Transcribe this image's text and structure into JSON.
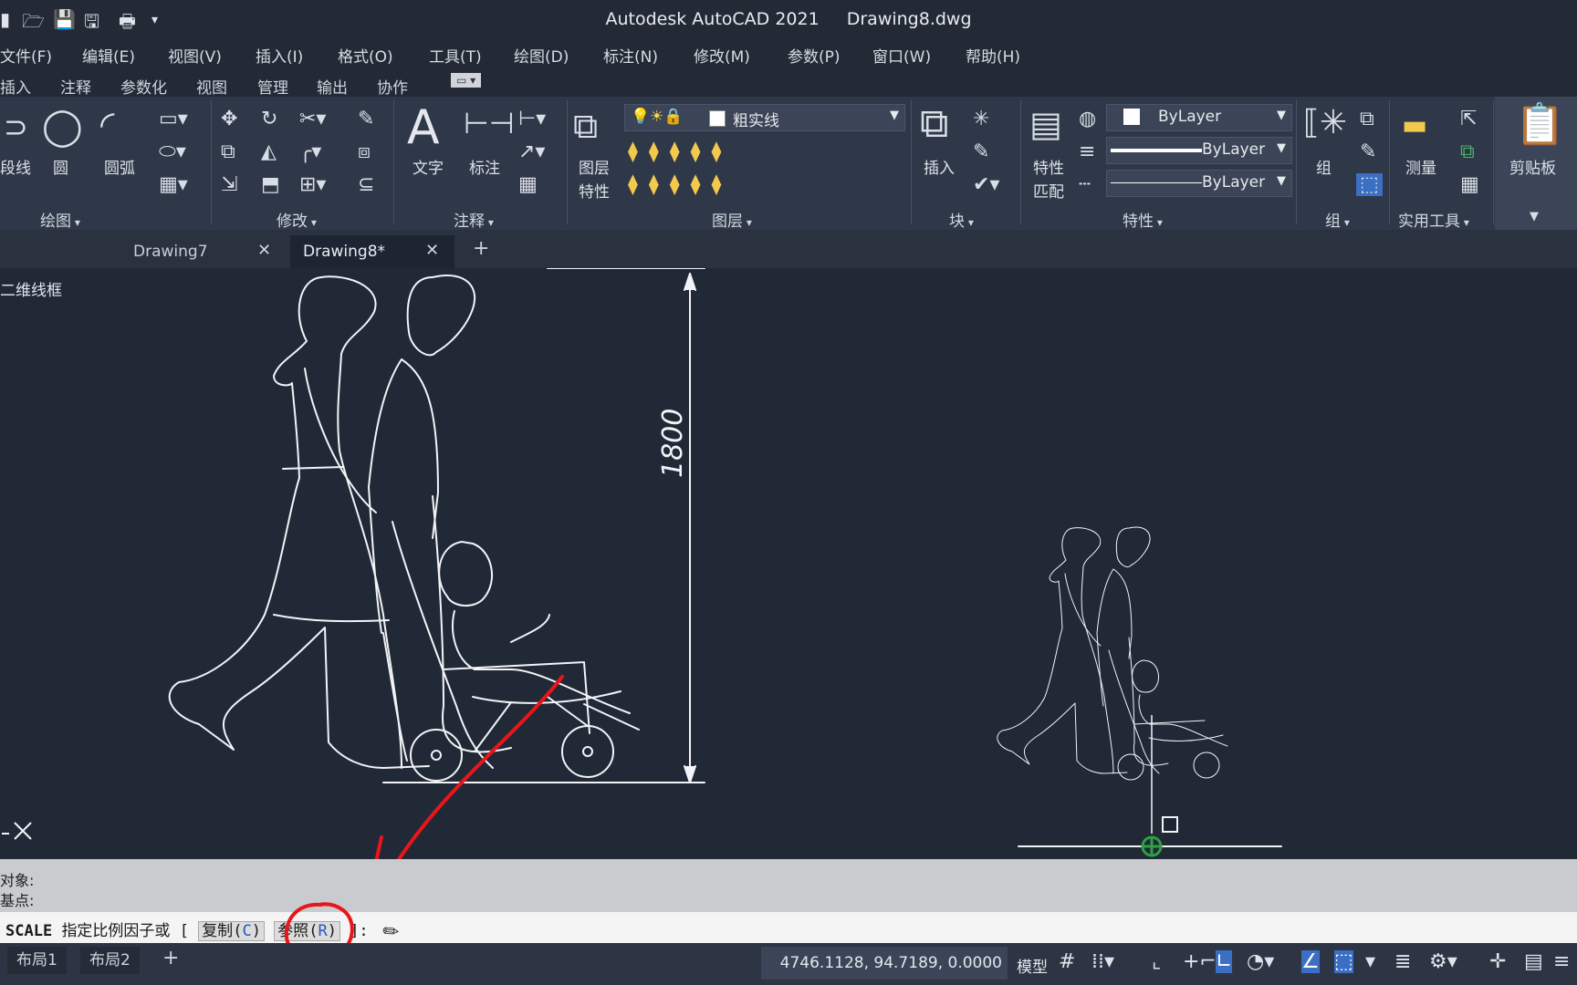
{
  "app": {
    "name": "Autodesk AutoCAD 2021",
    "file": "Drawing8.dwg"
  },
  "quick_access": {
    "icons": [
      "new-icon",
      "open-icon",
      "save-icon",
      "save-as-icon",
      "print-icon",
      "customize-icon"
    ]
  },
  "menu": [
    "文件(F)",
    "编辑(E)",
    "视图(V)",
    "插入(I)",
    "格式(O)",
    "工具(T)",
    "绘图(D)",
    "标注(N)",
    "修改(M)",
    "参数(P)",
    "窗口(W)",
    "帮助(H)"
  ],
  "ribbon_tabs": [
    "插入",
    "注释",
    "参数化",
    "视图",
    "管理",
    "输出",
    "协作"
  ],
  "ribbon": {
    "draw": {
      "title": "绘图",
      "polyline": "段线",
      "circle": "圆",
      "arc": "圆弧"
    },
    "modify": {
      "title": "修改"
    },
    "annotation": {
      "title": "注释",
      "text": "文字",
      "dimension": "标注"
    },
    "layers": {
      "title": "图层",
      "layer_props_line1": "图层",
      "layer_props_line2": "特性",
      "current_layer": "粗实线"
    },
    "block": {
      "title": "块",
      "insert": "插入"
    },
    "properties": {
      "title": "特性",
      "match_line1": "特性",
      "match_line2": "匹配",
      "color": "ByLayer",
      "lineweight": "ByLayer",
      "linetype": "ByLayer"
    },
    "groups": {
      "title": "组",
      "group": "组"
    },
    "utilities": {
      "title": "实用工具",
      "measure": "测量"
    },
    "clipboard": {
      "title": "剪贴板"
    }
  },
  "doc_tabs": [
    {
      "label": "Drawing7",
      "active": false
    },
    {
      "label": "Drawing8*",
      "active": true
    }
  ],
  "viewport": {
    "view_label": "二维线框",
    "dimension_text": "1800"
  },
  "command": {
    "history": [
      "对象:",
      "基点:"
    ],
    "prompt_cmd": "SCALE",
    "prompt_text": "指定比例因子或",
    "option_copy": "复制",
    "option_copy_key": "C",
    "option_ref": "参照",
    "option_ref_key": "R"
  },
  "status": {
    "layout_tabs": [
      "布局1",
      "布局2"
    ],
    "coords": "4746.1128, 94.7189, 0.0000",
    "model": "模型"
  },
  "colors": {
    "annotation_red": "#e8161a",
    "ucs_green": "#2ea043",
    "status_active": "#3a6fc4"
  }
}
